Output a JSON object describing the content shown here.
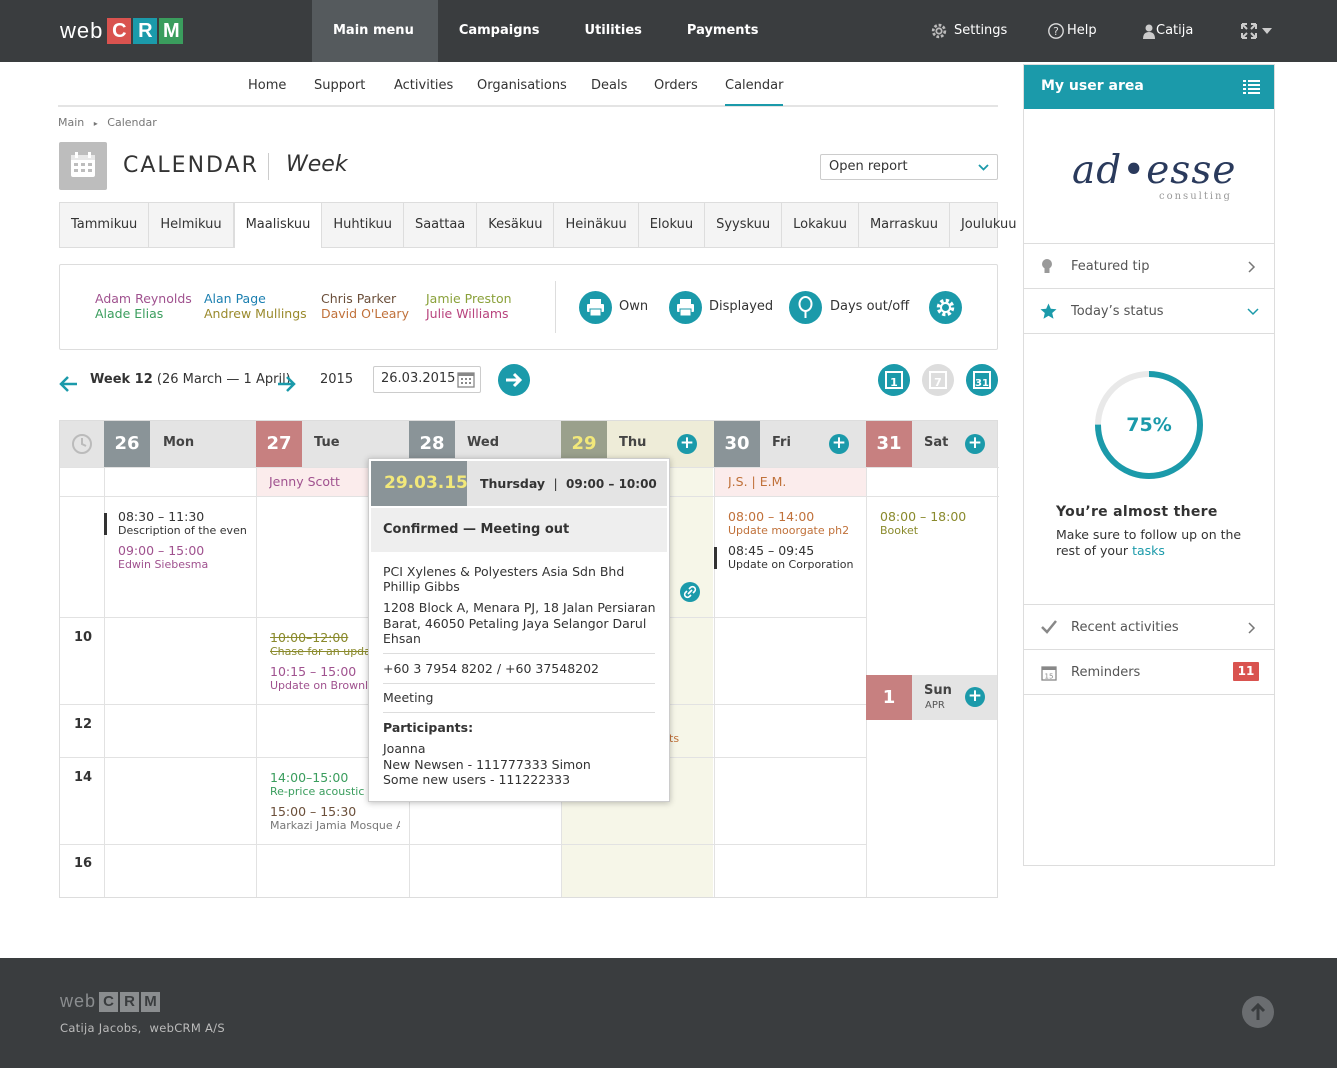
{
  "brand": {
    "web": "web",
    "letters": [
      "C",
      "R",
      "M"
    ],
    "colors": [
      "#d9534f",
      "#1b9aaa",
      "#3a9d5d"
    ]
  },
  "topnav": [
    {
      "label": "Main menu",
      "active": true
    },
    {
      "label": "Campaigns"
    },
    {
      "label": "Utilities"
    },
    {
      "label": "Payments"
    }
  ],
  "topright": {
    "settings": "Settings",
    "help": "Help",
    "user": "Catija"
  },
  "subnav": [
    {
      "label": "Home"
    },
    {
      "label": "Support"
    },
    {
      "label": "Activities"
    },
    {
      "label": "Organisations"
    },
    {
      "label": "Deals"
    },
    {
      "label": "Orders"
    },
    {
      "label": "Calendar",
      "active": true
    }
  ],
  "breadcrumb": {
    "main": "Main",
    "current": "Calendar"
  },
  "page": {
    "title": "CALENDAR",
    "subtitle": "Week",
    "report_select": "Open report"
  },
  "months": [
    {
      "label": "Tammikuu"
    },
    {
      "label": "Helmikuu"
    },
    {
      "label": "Maaliskuu",
      "active": true
    },
    {
      "label": "Huhtikuu"
    },
    {
      "label": "Saattaa"
    },
    {
      "label": "Kesäkuu"
    },
    {
      "label": "Heinäkuu"
    },
    {
      "label": "Elokuu"
    },
    {
      "label": "Syyskuu"
    },
    {
      "label": "Lokakuu"
    },
    {
      "label": "Marraskuu"
    },
    {
      "label": "Joulukuu"
    }
  ],
  "users": [
    {
      "name": "Adam Reynolds",
      "color": "#a0528f"
    },
    {
      "name": "Alade Elias",
      "color": "#3a9d5d"
    },
    {
      "name": "Alan Page",
      "color": "#1b7fb0"
    },
    {
      "name": "Andrew Mullings",
      "color": "#9a8a2c"
    },
    {
      "name": "Chris Parker",
      "color": "#6b4f3a"
    },
    {
      "name": "David O'Leary",
      "color": "#c0713a"
    },
    {
      "name": "Jamie Preston",
      "color": "#8aa13a"
    },
    {
      "name": "Julie Williams",
      "color": "#b8437d"
    }
  ],
  "print_buttons": {
    "own": "Own",
    "displayed": "Displayed",
    "days_out": "Days out/off"
  },
  "week": {
    "label": "Week 12",
    "range": "(26 March — 1 April)",
    "year": "2015",
    "date": "26.03.2015"
  },
  "days": [
    {
      "num": "26",
      "name": "Mon",
      "color": "#8a9498"
    },
    {
      "num": "27",
      "name": "Tue",
      "color": "#c78080"
    },
    {
      "num": "28",
      "name": "Wed",
      "color": "#8a9498"
    },
    {
      "num": "29",
      "name": "Thu",
      "color": "#9aa08c",
      "numcolor": "#f2e87a"
    },
    {
      "num": "30",
      "name": "Fri",
      "color": "#8a9498"
    },
    {
      "num": "31",
      "name": "Sat",
      "color": "#c78080"
    }
  ],
  "sunday": {
    "num": "1",
    "name": "Sun",
    "month": "APR"
  },
  "hours": [
    "10",
    "12",
    "14",
    "16"
  ],
  "allday": {
    "tue": "Jenny Scott",
    "fri": "J.S. | E.M."
  },
  "events": {
    "mon1": {
      "time": "08:30 – 11:30",
      "desc": "Description of the event"
    },
    "mon2": {
      "time": "09:00 – 15:00",
      "desc": "Edwin Siebesma"
    },
    "tue1": {
      "time": "10:00–12:00",
      "desc": "Chase for an update"
    },
    "tue2": {
      "time": "10:15 – 15:00",
      "desc": "Update on Brownlee"
    },
    "tue3": {
      "time": "14:00–15:00",
      "desc": "Re-price acoustic fl"
    },
    "tue4": {
      "time": "15:00 – 15:30",
      "desc": "Markazi Jamia Mosque A"
    },
    "fri1": {
      "time": "08:00 – 14:00",
      "desc": "Update moorgate ph2"
    },
    "fri2": {
      "time": "08:45 – 09:45",
      "desc": "Update on Corporation"
    },
    "sat1": {
      "time": "08:00 – 18:00",
      "desc": "Booket"
    },
    "thu_frag": "ts"
  },
  "popup": {
    "date": "29.03.15",
    "day": "Thursday",
    "time": "09:00 – 10:00",
    "status": "Confirmed — Meeting out",
    "company": "PCI Xylenes & Polyesters Asia Sdn Bhd Phillip Gibbs",
    "address": "1208 Block A, Menara PJ, 18 Jalan Persiaran Barat, 46050 Petaling Jaya Selangor Darul Ehsan",
    "phone": "+60 3 7954 8202 / +60 37548202",
    "type": "Meeting",
    "participants_label": "Participants:",
    "participants": [
      "Joanna",
      "New Newsen - 111777333 Simon",
      "Some new users - 111222333"
    ]
  },
  "rightpanel": {
    "title": "My user area",
    "logo_main": "ad•esse",
    "logo_sub": "consulting",
    "featured": "Featured tip",
    "status": "Today’s status",
    "progress": 75,
    "progress_label": "75%",
    "almost": "You’re almost there",
    "follow": "Make sure to follow up on the rest of your",
    "tasks": "tasks",
    "recent": "Recent activities",
    "reminders": "Reminders",
    "reminders_count": "11"
  },
  "footer": {
    "logo_web": "web",
    "logo_letters": [
      "C",
      "R",
      "M"
    ],
    "credit": "Catija Jacobs,  webCRM A/S"
  }
}
